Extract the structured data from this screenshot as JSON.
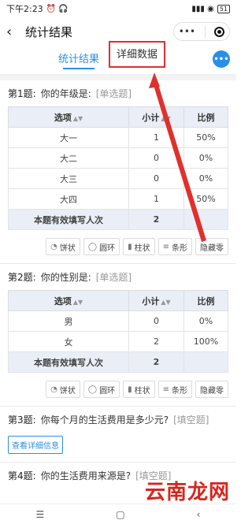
{
  "status": {
    "time": "下午2:23",
    "icons_left": "⏰ 🎧",
    "battery": "51"
  },
  "nav": {
    "title": "统计结果",
    "more": "•••"
  },
  "tabs": [
    {
      "label": "统计结果",
      "active": true
    },
    {
      "label": "详细数据",
      "highlighted": true
    }
  ],
  "more_button": "•••",
  "chart_buttons": [
    "饼状",
    "圆环",
    "柱状",
    "条形",
    "隐藏零"
  ],
  "table_headers": {
    "option": "选项",
    "count": "小计",
    "ratio": "比例"
  },
  "q1": {
    "no": "第1题:",
    "text": "你的年级是:",
    "type": "[单选题]",
    "rows": [
      {
        "option": "大一",
        "count": "1",
        "ratio": "50%"
      },
      {
        "option": "大二",
        "count": "0",
        "ratio": "0%"
      },
      {
        "option": "大三",
        "count": "0",
        "ratio": "0%"
      },
      {
        "option": "大四",
        "count": "1",
        "ratio": "50%"
      }
    ],
    "total_label": "本题有效填写人次",
    "total_value": "2"
  },
  "q2": {
    "no": "第2题:",
    "text": "你的性别是:",
    "type": "[单选题]",
    "rows": [
      {
        "option": "男",
        "count": "0",
        "ratio": "0%"
      },
      {
        "option": "女",
        "count": "2",
        "ratio": "100%"
      }
    ],
    "total_label": "本题有效填写人次",
    "total_value": "2"
  },
  "q3": {
    "no": "第3题:",
    "text": "你每个月的生活费用是多少元?",
    "type": "[填空题]",
    "detail": "查看详细信息"
  },
  "q4": {
    "no": "第4题:",
    "text": "你的生活费用来源是?",
    "type": "[填空题]"
  },
  "watermark": "云南龙网",
  "sysnav": {
    "menu": "☰",
    "home": "▢",
    "back": "‹"
  },
  "colors": {
    "accent": "#2a8fe6",
    "highlight": "#e0302c",
    "header_bg": "#e9eef7"
  }
}
